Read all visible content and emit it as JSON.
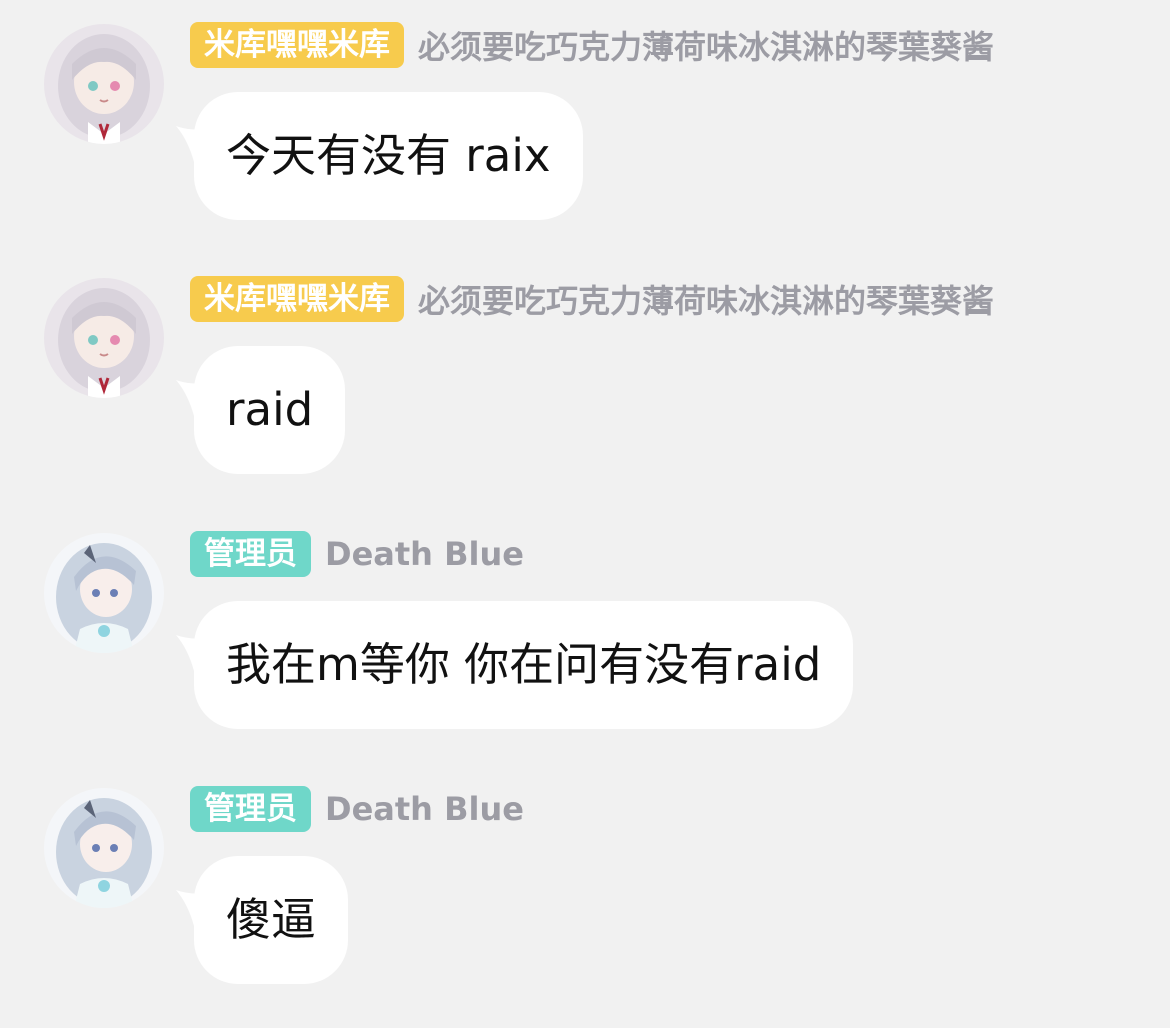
{
  "colors": {
    "background": "#f1f1f1",
    "bubble": "#ffffff",
    "name_text": "#9c9ca4",
    "badge_gold": "#f7cb4d",
    "badge_teal": "#6fd7c9"
  },
  "messages": [
    {
      "badge": "米库嘿嘿米库",
      "badge_color": "#f7cb4d",
      "sender": "必须要吃巧克力薄荷味冰淇淋的琴葉葵酱",
      "text": "今天有没有 raix",
      "avatar": "anime-girl-pink-ribbon-avatar"
    },
    {
      "badge": "米库嘿嘿米库",
      "badge_color": "#f7cb4d",
      "sender": "必须要吃巧克力薄荷味冰淇淋的琴葉葵酱",
      "text": "raid",
      "avatar": "anime-girl-pink-ribbon-avatar"
    },
    {
      "badge": "管理员",
      "badge_color": "#6fd7c9",
      "sender": "Death Blue",
      "text": "我在m等你 你在问有没有raid",
      "avatar": "anime-girl-blue-hair-avatar"
    },
    {
      "badge": "管理员",
      "badge_color": "#6fd7c9",
      "sender": "Death Blue",
      "text": "傻逼",
      "avatar": "anime-girl-blue-hair-avatar"
    }
  ]
}
